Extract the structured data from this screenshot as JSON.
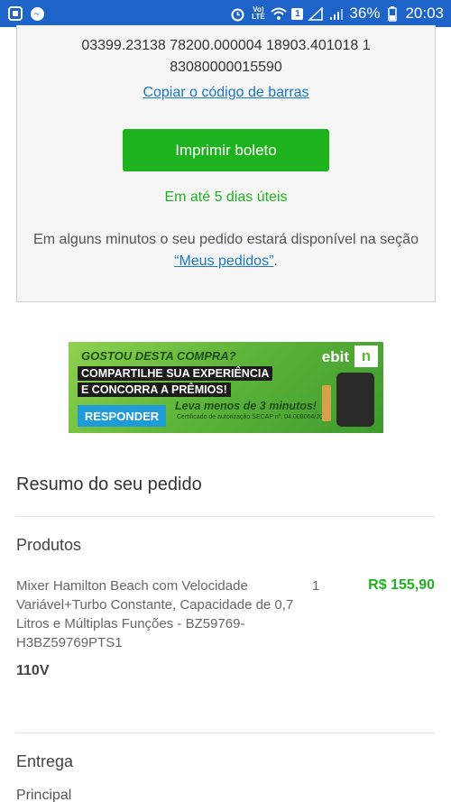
{
  "status_bar": {
    "icons_left": [
      "gallery-icon",
      "messenger-icon"
    ],
    "volte": "Vo) LTE",
    "notification_count": "1",
    "battery": "36%",
    "time": "20:03"
  },
  "payment": {
    "barcode_line1": "03399.23138 78200.000004 18903.401018 1",
    "barcode_line2": "83080000015590",
    "copy_label": "Copiar o código de barras",
    "print_label": "Imprimir boleto",
    "days_note": "Em até 5 dias úteis",
    "info_text": "Em alguns minutos o seu pedido estará disponível na seção",
    "info_link": "“Meus pedidos”",
    "info_end": "."
  },
  "banner": {
    "headline": "GOSTOU DESTA COMPRA?",
    "line1": "COMPARTILHE SUA EXPERIÊNCIA",
    "line2": "E CONCORRA A PRÊMIOS!",
    "button": "RESPONDER",
    "leva": "Leva menos de 3 minutos!",
    "cert": "Certificado de autorização SECAP nº. 04.008064/2020",
    "logo": "ebit",
    "logo_n": "n"
  },
  "summary": {
    "title": "Resumo do seu pedido",
    "produtos_title": "Produtos",
    "product": {
      "name": "Mixer Hamilton Beach com Velocidade Variável+Turbo Constante, Capacidade de 0,7 Litros e Múltiplas Funções - BZ59769-H3BZ59769PTS1",
      "qty": "1",
      "price": "R$ 155,90",
      "variant": "110V"
    },
    "entrega_title": "Entrega",
    "entrega_sub": "Principal"
  },
  "colors": {
    "status_bar": "#1e63c8",
    "accent_green": "#1eb21e",
    "link_blue": "#1a77c9"
  }
}
